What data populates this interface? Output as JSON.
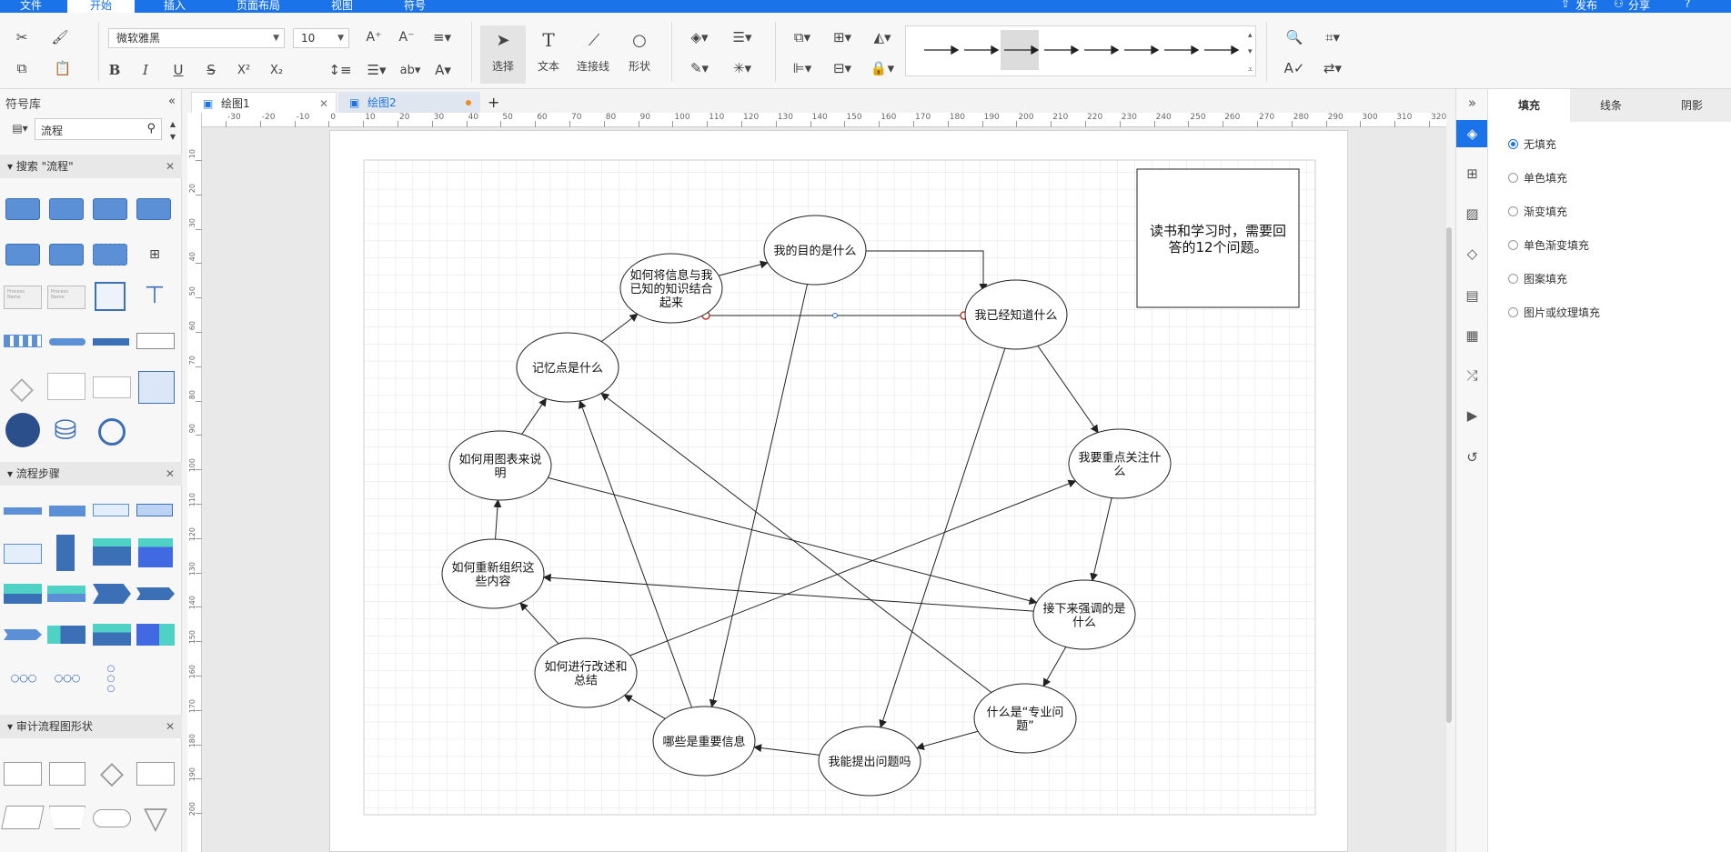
{
  "menu": {
    "items": [
      "文件",
      "开始",
      "插入",
      "页面布局",
      "视图",
      "符号"
    ],
    "active_index": 1,
    "right": [
      "发布",
      "分享"
    ]
  },
  "toolbar": {
    "font_name": "微软雅黑",
    "font_size": "10",
    "select_label": "选择",
    "text_label": "文本",
    "connector_label": "连接线",
    "shape_label": "形状"
  },
  "library": {
    "title": "符号库",
    "search_value": "流程",
    "sections": [
      "搜索 \"流程\"",
      "流程步骤",
      "审计流程图形状"
    ],
    "process_name_label": "Process Name"
  },
  "tabs": [
    {
      "label": "绘图1",
      "active": false
    },
    {
      "label": "绘图2",
      "active": true
    }
  ],
  "rulers": {
    "h_ticks": [
      "-30",
      "-20",
      "-10",
      "0",
      "10",
      "20",
      "30",
      "40",
      "50",
      "60",
      "70",
      "80",
      "90",
      "100",
      "110",
      "120",
      "130",
      "140",
      "150",
      "160",
      "170",
      "180",
      "190",
      "200",
      "210",
      "220",
      "230",
      "240",
      "250",
      "260",
      "270",
      "280",
      "290",
      "300",
      "310",
      "320"
    ],
    "v_ticks": [
      "10",
      "20",
      "30",
      "40",
      "50",
      "60",
      "70",
      "80",
      "90",
      "100",
      "110",
      "120",
      "130",
      "140",
      "150",
      "160",
      "170",
      "180",
      "190",
      "200"
    ]
  },
  "diagram": {
    "title_box": [
      "读书和学习时，需要回",
      "答的12个问题。"
    ],
    "nodes": [
      {
        "id": "n1",
        "lines": [
          "我的目的是什么"
        ]
      },
      {
        "id": "n2",
        "lines": [
          "我已经知道什么"
        ]
      },
      {
        "id": "n3",
        "lines": [
          "我要重点关注什",
          "么"
        ]
      },
      {
        "id": "n4",
        "lines": [
          "接下来强调的是",
          "什么"
        ]
      },
      {
        "id": "n5",
        "lines": [
          "什么是“专业问",
          "题”"
        ]
      },
      {
        "id": "n6",
        "lines": [
          "我能提出问题吗"
        ]
      },
      {
        "id": "n7",
        "lines": [
          "哪些是重要信息"
        ]
      },
      {
        "id": "n8",
        "lines": [
          "如何进行改述和",
          "总结"
        ]
      },
      {
        "id": "n9",
        "lines": [
          "如何重新组织这",
          "些内容"
        ]
      },
      {
        "id": "n10",
        "lines": [
          "如何用图表来说",
          "明"
        ]
      },
      {
        "id": "n11",
        "lines": [
          "记忆点是什么"
        ]
      },
      {
        "id": "n12",
        "lines": [
          "如何将信息与我",
          "已知的知识结合",
          "起来"
        ]
      }
    ]
  },
  "rightpanel": {
    "tabs": [
      "填充",
      "线条",
      "阴影"
    ],
    "active_tab": 0,
    "options": [
      "无填充",
      "单色填充",
      "渐变填充",
      "单色渐变填充",
      "图案填充",
      "图片或纹理填充"
    ],
    "selected_option": 0
  },
  "colors": {
    "accent": "#1a73e8",
    "flow_shape": "#5b8fd6",
    "modified_dot": "#f08a24"
  }
}
